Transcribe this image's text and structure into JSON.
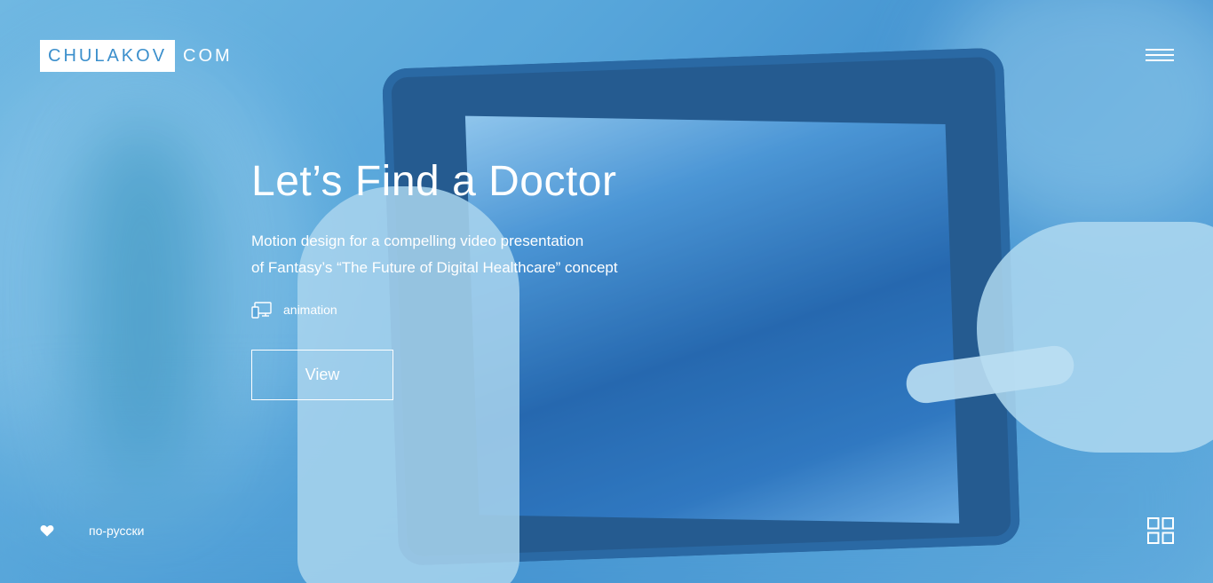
{
  "header": {
    "logo_main": "CHULAKOV",
    "logo_suffix": "COM"
  },
  "hero": {
    "title": "Let’s Find a Doctor",
    "description_line1": "Motion design for a compelling video presentation",
    "description_line2": "of Fantasy’s “The Future of Digital Healthcare” concept",
    "category_icon": "devices-icon",
    "category_label": "animation",
    "view_label": "View"
  },
  "footer": {
    "favorite_icon": "heart-icon",
    "language_link": "по-русски",
    "grid_icon": "grid-icon"
  },
  "colors": {
    "accent": "#3b8fcc",
    "text": "#ffffff"
  }
}
